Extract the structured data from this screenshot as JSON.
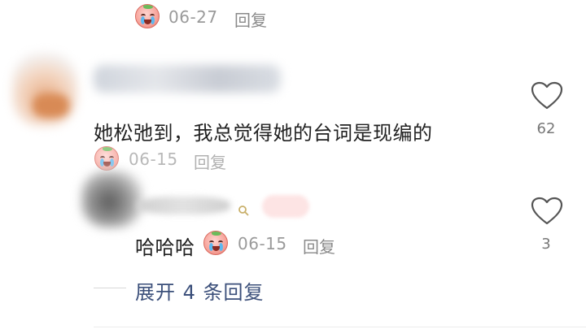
{
  "top_row": {
    "date": "06-27",
    "reply_label": "回复"
  },
  "comment1": {
    "username": "",
    "text": "她松弛到，我总觉得她的台词是现编的",
    "date": "06-15",
    "reply_label": "回复",
    "like_count": "62"
  },
  "comment2": {
    "username": "",
    "text": "哈哈哈",
    "date": "06-15",
    "reply_label": "回复",
    "like_count": "3"
  },
  "expand": {
    "label": "展开 4 条回复"
  },
  "colors": {
    "accent_link": "#3b4f7a",
    "meta_gray": "#9a9a9a"
  },
  "icons": [
    "crying-emoji-icon",
    "heart-outline-icon",
    "search-icon"
  ]
}
